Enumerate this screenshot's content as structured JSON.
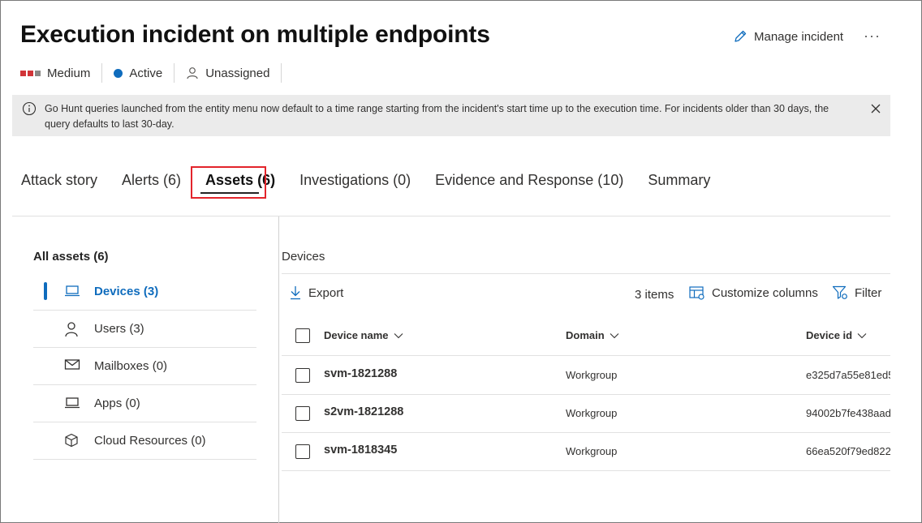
{
  "header": {
    "title": "Execution incident on multiple endpoints",
    "manage_label": "Manage incident",
    "more_label": "···",
    "severity": "Medium",
    "status": "Active",
    "assignee": "Unassigned",
    "colors": {
      "severity_red": "#d13438",
      "severity_grey": "#8a8886",
      "status_blue": "#0f6cbd"
    }
  },
  "banner": {
    "text": "Go Hunt queries launched from the entity menu now default to a time range starting from the incident's start time up to the execution time. For incidents older than 30 days, the query defaults to last 30-day.",
    "icon": "info-icon",
    "close_icon": "close-icon"
  },
  "tabs": [
    {
      "label": "Attack story"
    },
    {
      "label": "Alerts (6)"
    },
    {
      "label": "Assets (6)",
      "active": true
    },
    {
      "label": "Investigations (0)"
    },
    {
      "label": "Evidence and Response (10)"
    },
    {
      "label": "Summary"
    }
  ],
  "sidebar": {
    "all_assets": "All assets (6)",
    "items": [
      {
        "label": "Devices (3)",
        "icon": "laptop-icon",
        "active": true
      },
      {
        "label": "Users (3)",
        "icon": "person-icon"
      },
      {
        "label": "Mailboxes (0)",
        "icon": "mail-icon"
      },
      {
        "label": "Apps (0)",
        "icon": "laptop-icon"
      },
      {
        "label": "Cloud Resources (0)",
        "icon": "cube-icon"
      }
    ]
  },
  "main": {
    "section_title": "Devices",
    "toolbar": {
      "export_label": "Export",
      "items_count": "3 items",
      "customize_label": "Customize columns",
      "filter_label": "Filter"
    },
    "columns": [
      "Device name",
      "Domain",
      "Device id"
    ],
    "rows": [
      {
        "device_name": "svm-1821288",
        "domain": "Workgroup",
        "device_id": "e325d7a55e81ed5"
      },
      {
        "device_name": "s2vm-1821288",
        "domain": "Workgroup",
        "device_id": "94002b7fe438aad"
      },
      {
        "device_name": "svm-1818345",
        "domain": "Workgroup",
        "device_id": "66ea520f79ed822"
      }
    ]
  }
}
